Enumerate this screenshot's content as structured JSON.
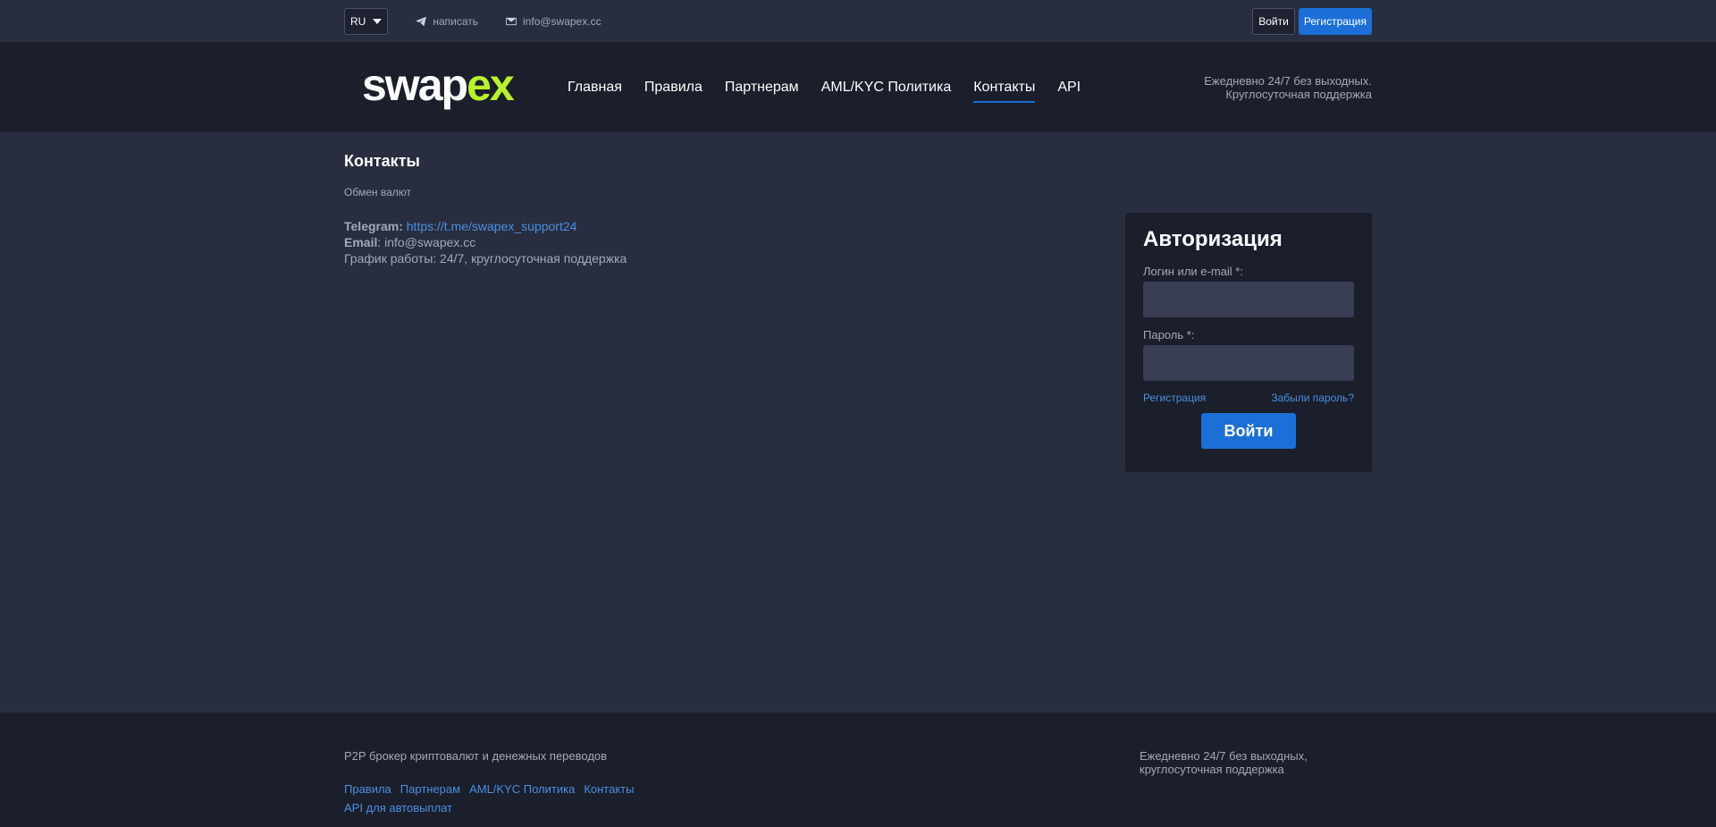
{
  "topbar": {
    "language": "RU",
    "write_label": "написать",
    "email_label": "info@swapex.cc",
    "login_button": "Войти",
    "register_button": "Регистрация"
  },
  "header": {
    "logo_text_white": "swap",
    "logo_text_green": "ex",
    "nav": [
      {
        "label": "Главная"
      },
      {
        "label": "Правила"
      },
      {
        "label": "Партнерам"
      },
      {
        "label": "AML/KYC Политика"
      },
      {
        "label": "Контакты"
      },
      {
        "label": "API"
      }
    ],
    "note_line1": "Ежедневно 24/7 без выходных.",
    "note_line2": "Круглосуточная поддержка"
  },
  "main": {
    "title": "Контакты",
    "subtitle": "Обмен валют",
    "telegram_label": "Telegram:",
    "telegram_link": "https://t.me/swapex_support24",
    "email_label": "Email",
    "email_value": ": info@swapex.cc",
    "schedule": "График работы: 24/7, круглосуточная поддержка"
  },
  "auth": {
    "title": "Авторизация",
    "login_label": "Логин или e-mail *:",
    "password_label": "Пароль *:",
    "register_link": "Регистрация",
    "forgot_link": "Забыли пароль?",
    "submit": "Войти"
  },
  "footer": {
    "description": "P2P брокер криптовалют и денежных переводов",
    "links": [
      {
        "label": "Правила"
      },
      {
        "label": "Партнерам"
      },
      {
        "label": "AML/KYC Политика"
      },
      {
        "label": "Контакты"
      }
    ],
    "api_link": "API для автовыплат",
    "note_line1": "Ежедневно 24/7 без выходных,",
    "note_line2": "круглосуточная поддержка"
  },
  "colors": {
    "accent": "#1b6fd6",
    "logo_green": "#b8f229",
    "background": "#282d3f",
    "panel": "#1b1e2b"
  }
}
